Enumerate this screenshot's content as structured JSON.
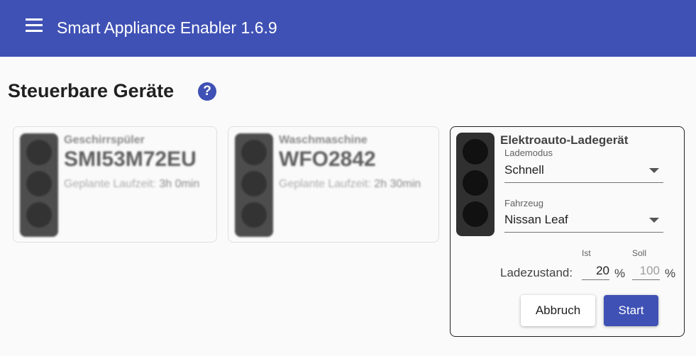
{
  "header": {
    "title": "Smart Appliance Enabler 1.6.9",
    "menu_icon": "menu-icon"
  },
  "page": {
    "title": "Steuerbare Geräte",
    "help_icon_glyph": "?"
  },
  "devices": [
    {
      "type": "Geschirrspüler",
      "id": "SMI53M72EU",
      "runtime_label": "Geplante Laufzeit:",
      "runtime_value": "3h 0min"
    },
    {
      "type": "Waschmaschine",
      "id": "WFO2842",
      "runtime_label": "Geplante Laufzeit:",
      "runtime_value": "2h 30min"
    }
  ],
  "ev_charger": {
    "title": "Elektroauto-Ladegerät",
    "mode_label": "Lademodus",
    "mode_value": "Schnell",
    "vehicle_label": "Fahrzeug",
    "vehicle_value": "Nissan Leaf",
    "soc_label": "Ladezustand:",
    "soc_actual_label": "Ist",
    "soc_actual_value": "20",
    "soc_target_label": "Soll",
    "soc_target_placeholder": "100",
    "percent_unit": "%",
    "cancel_label": "Abbruch",
    "start_label": "Start"
  },
  "colors": {
    "primary": "#3f51b5",
    "traffic_light_body": "#303030",
    "traffic_light_off": "#111111"
  }
}
